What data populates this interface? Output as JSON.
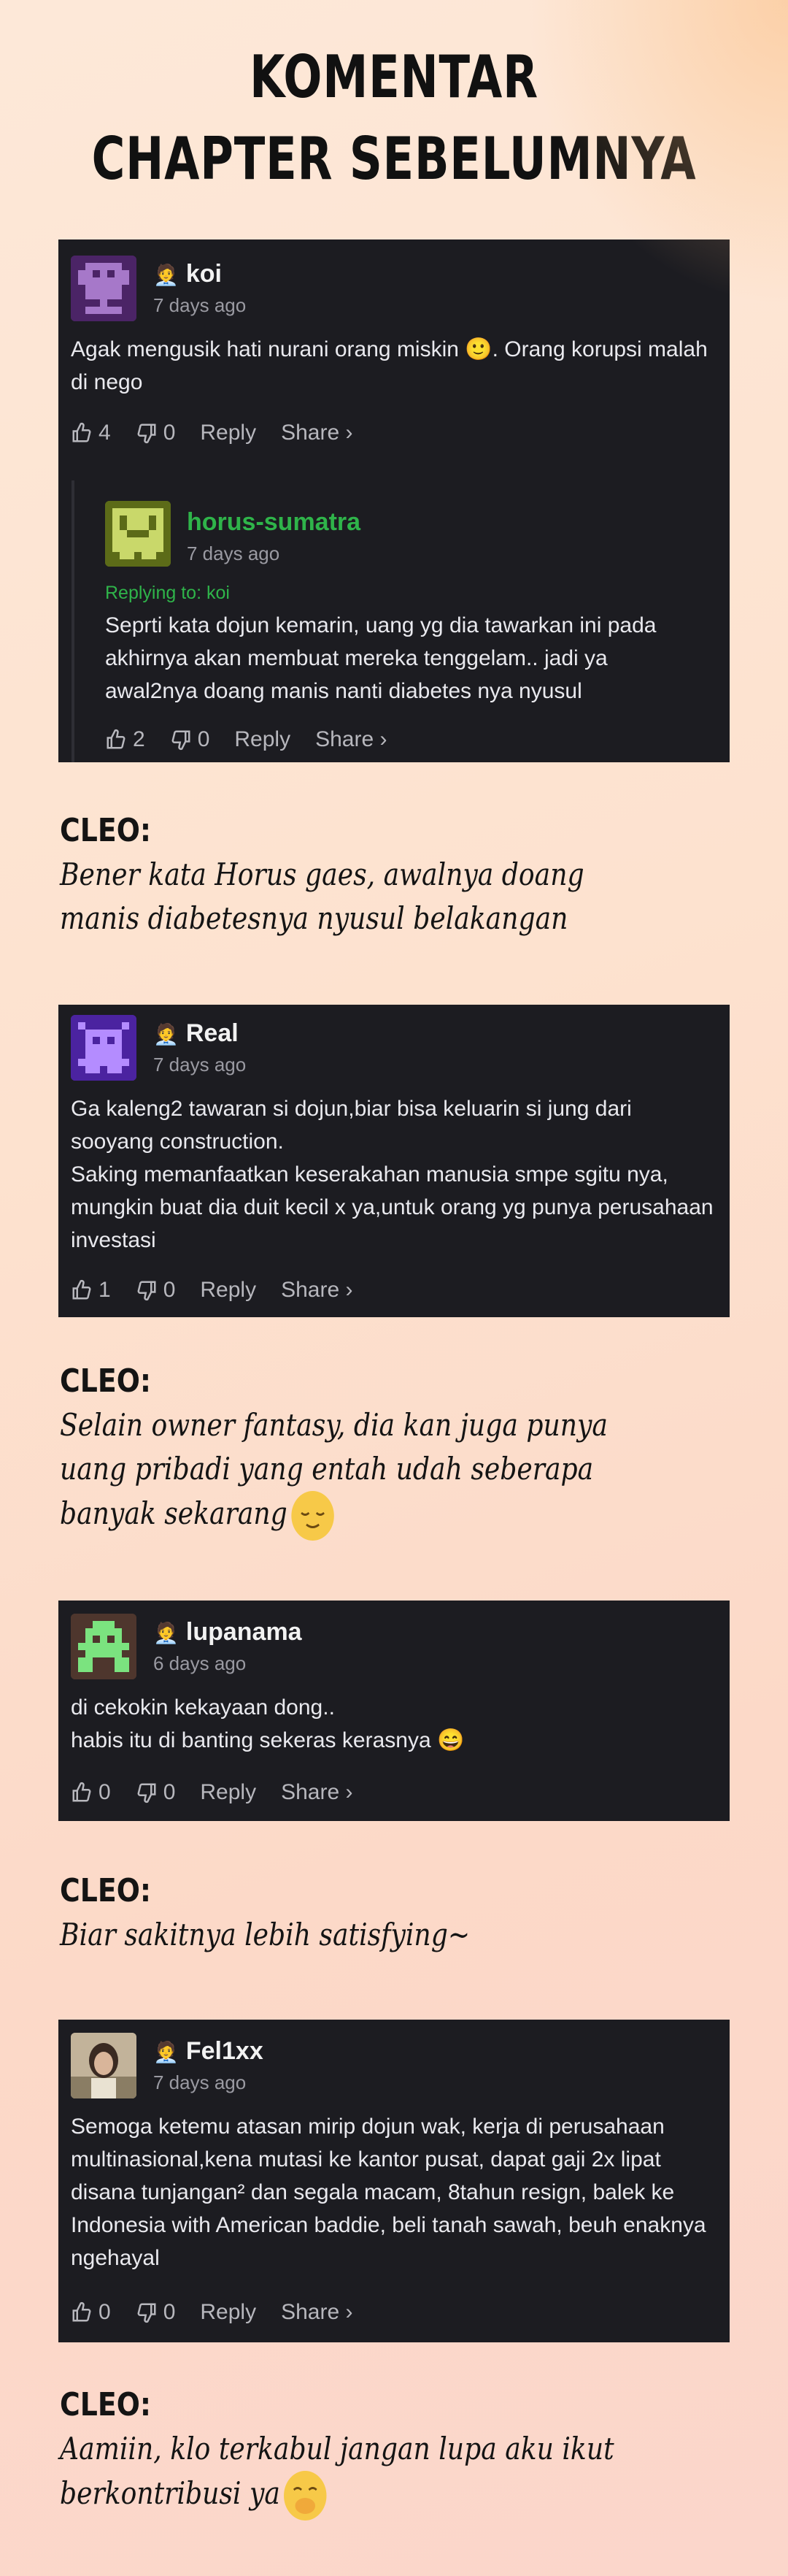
{
  "title": {
    "line1": "KOMENTAR",
    "line2": "CHAPTER SEBELUMNYA"
  },
  "comments": [
    {
      "user": "koi",
      "time": "7 days ago",
      "text": "Agak mengusik hati nurani orang miskin 🙂. Orang korupsi malah di nego",
      "likes": "4",
      "dislikes": "0",
      "reply_label": "Reply",
      "share_label": "Share ›",
      "reply": {
        "user": "horus-sumatra",
        "time": "7 days ago",
        "replying_to": "Replying to: koi",
        "text": "Seprti kata dojun kemarin, uang yg dia tawarkan ini pada akhirnya akan membuat mereka tenggelam.. jadi ya awal2nya doang manis nanti diabetes nya nyusul",
        "likes": "2",
        "dislikes": "0",
        "reply_label": "Reply",
        "share_label": "Share ›"
      }
    },
    {
      "user": "Real",
      "time": "7 days ago",
      "text": "Ga kaleng2 tawaran si dojun,biar bisa keluarin si jung dari sooyang construction.\nSaking memanfaatkan keserakahan manusia smpe sgitu nya, mungkin buat dia duit kecil x ya,untuk orang yg punya perusahaan investasi",
      "likes": "1",
      "dislikes": "0",
      "reply_label": "Reply",
      "share_label": "Share ›"
    },
    {
      "user": "lupanama",
      "time": "6 days ago",
      "text": "di cekokin kekayaan dong..\nhabis itu di banting sekeras kerasnya 😄",
      "likes": "0",
      "dislikes": "0",
      "reply_label": "Reply",
      "share_label": "Share ›"
    },
    {
      "user": "Fel1xx",
      "time": "7 days ago",
      "text": "Semoga ketemu atasan mirip dojun wak, kerja di perusahaan multinasional,kena mutasi ke kantor pusat, dapat gaji 2x lipat disana tunjangan² dan segala macam, 8tahun resign, balek ke Indonesia with American baddie, beli tanah sawah, beuh enaknya ngehayal",
      "likes": "0",
      "dislikes": "0",
      "reply_label": "Reply",
      "share_label": "Share ›"
    }
  ],
  "cleo": [
    {
      "who": "CLEO:",
      "text": "Bener kata Horus gaes, awalnya doang manis diabetesnya nyusul belakangan"
    },
    {
      "who": "CLEO:",
      "text": "Selain owner fantasy, dia kan juga punya uang pribadi yang entah udah seberapa banyak sekarang"
    },
    {
      "who": "CLEO:",
      "text": "Biar sakitnya lebih satisfying~"
    },
    {
      "who": "CLEO:",
      "text": "Aamiin, klo terkabul jangan lupa aku ikut berkontribusi ya"
    }
  ],
  "colors": {
    "card_bg": "#1c1c21",
    "reply_green": "#2fb44a",
    "text_muted": "#9a9aa2"
  }
}
